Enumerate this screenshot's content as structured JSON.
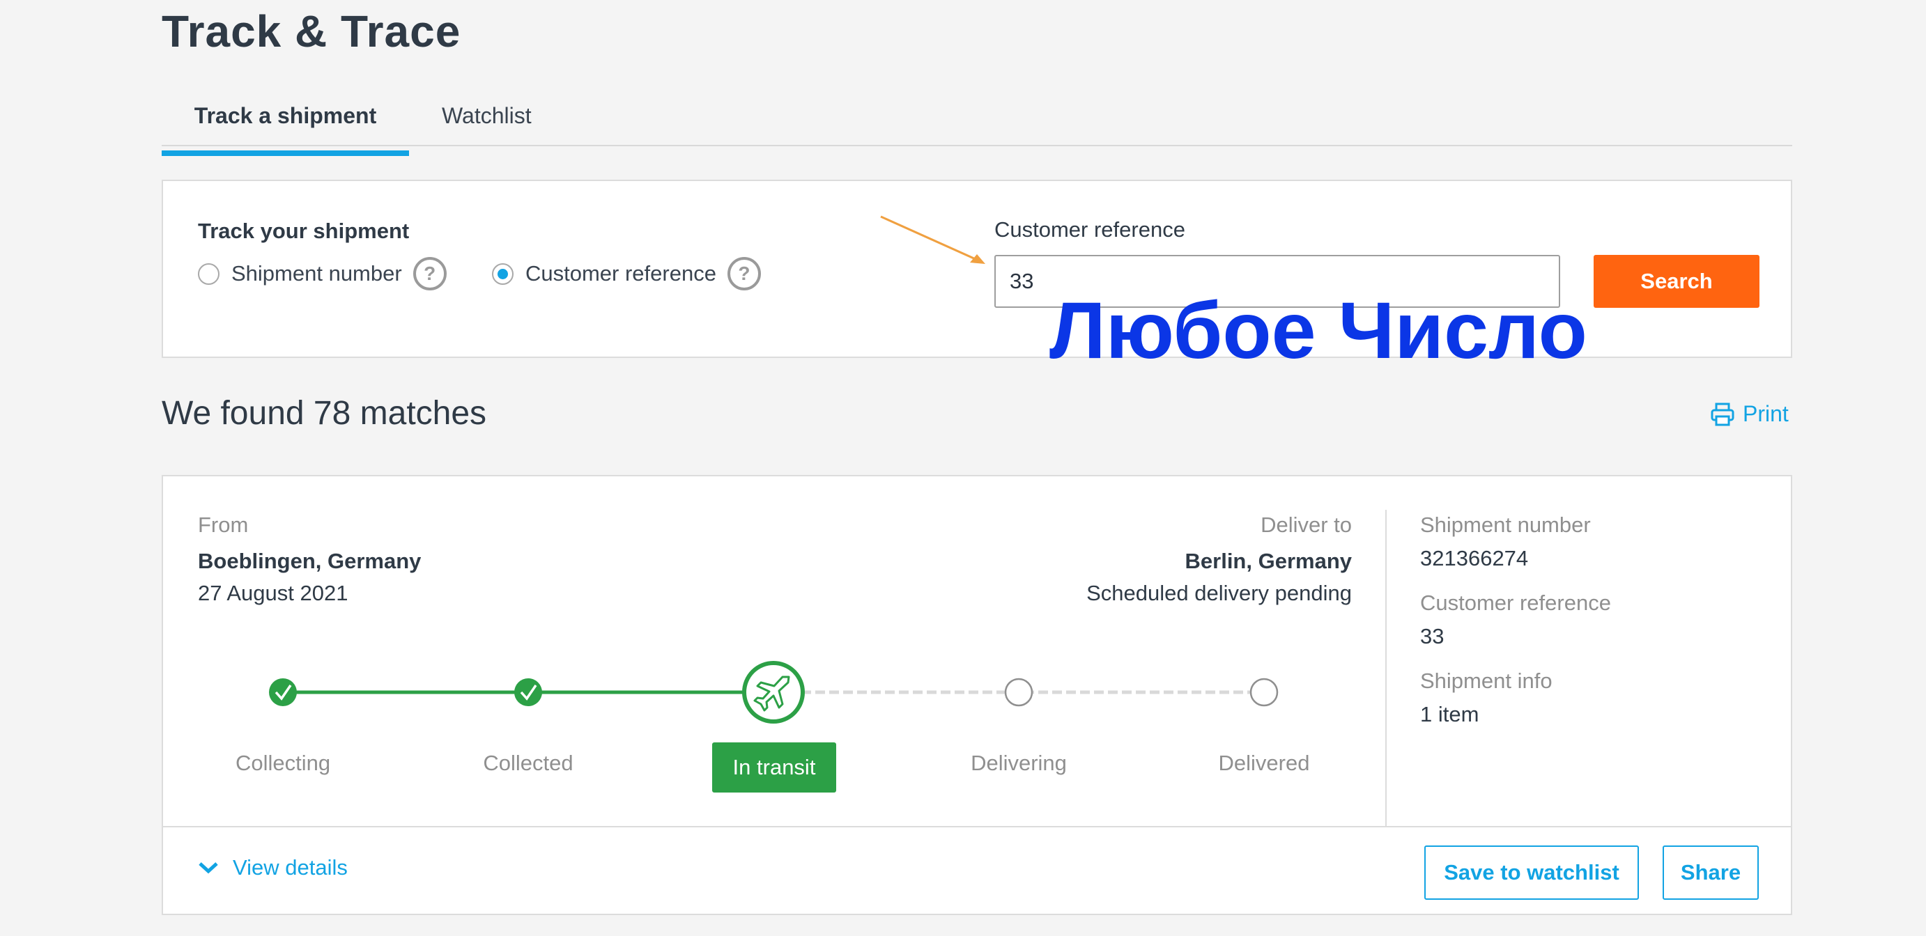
{
  "page": {
    "title": "Track & Trace"
  },
  "tabs": [
    {
      "label": "Track a shipment",
      "active": true
    },
    {
      "label": "Watchlist",
      "active": false
    }
  ],
  "search": {
    "heading": "Track your shipment",
    "options": [
      {
        "label": "Shipment number",
        "checked": false
      },
      {
        "label": "Customer reference",
        "checked": true
      }
    ],
    "help_glyph": "?",
    "field_label": "Customer reference",
    "field_value": "33",
    "button_label": "Search"
  },
  "annotation": {
    "text": "Любое Число",
    "color": "#0b36e6"
  },
  "results": {
    "summary": "We found 78 matches",
    "print_label": "Print"
  },
  "shipment": {
    "from_label": "From",
    "from_city": "Boeblingen, Germany",
    "from_date": "27 August 2021",
    "to_label": "Deliver to",
    "to_city": "Berlin, Germany",
    "to_status": "Scheduled delivery pending",
    "steps": [
      {
        "label": "Collecting",
        "state": "done"
      },
      {
        "label": "Collected",
        "state": "done"
      },
      {
        "label": "In transit",
        "state": "current"
      },
      {
        "label": "Delivering",
        "state": "pending"
      },
      {
        "label": "Delivered",
        "state": "pending"
      }
    ],
    "info": {
      "shipment_number_label": "Shipment number",
      "shipment_number": "321366274",
      "customer_reference_label": "Customer reference",
      "customer_reference": "33",
      "shipment_info_label": "Shipment info",
      "shipment_info": "1 item"
    },
    "actions": {
      "view_details": "View details",
      "save": "Save to watchlist",
      "share": "Share"
    }
  },
  "colors": {
    "accent": "#12a3e3",
    "search_button": "#ff6410",
    "progress_done": "#2ca046",
    "arrow": "#f0a040"
  }
}
